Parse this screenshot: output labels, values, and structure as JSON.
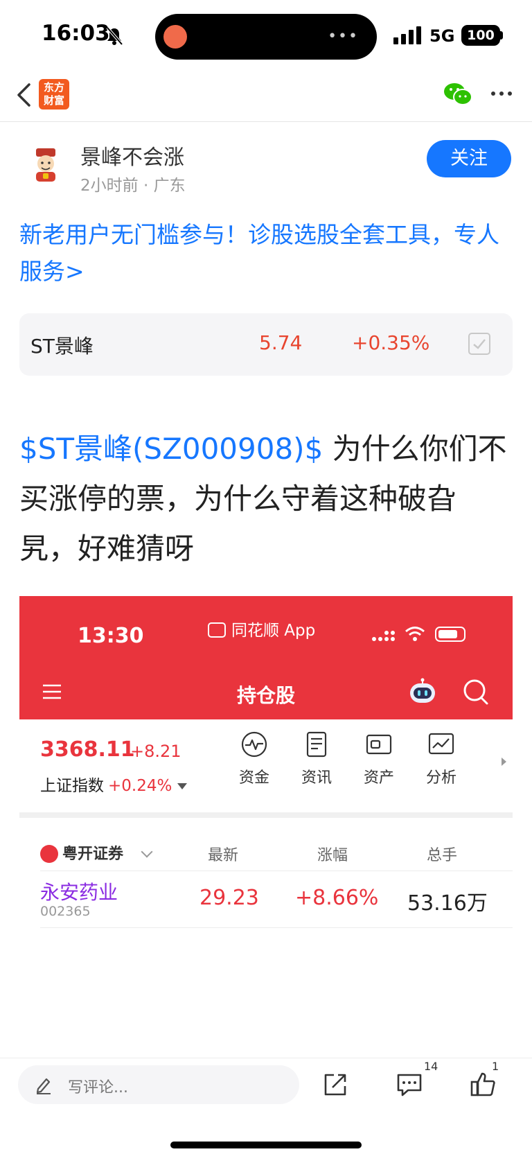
{
  "status_bar": {
    "time": "16:03",
    "network": "5G",
    "battery": "100"
  },
  "nav": {
    "logo_text": "东方财富",
    "back_icon": "chevron-left-icon",
    "share_icon": "wechat-icon",
    "more_icon": "more-icon"
  },
  "author": {
    "name": "景峰不会涨",
    "meta": "2小时前 · 广东",
    "follow_label": "关注"
  },
  "promo": {
    "text": "新老用户无门槛参与！诊股选股全套工具，专人服务>"
  },
  "stock_card": {
    "name": "ST景峰",
    "price": "5.74",
    "change": "+0.35%"
  },
  "post": {
    "stock_tag": "$ST景峰(SZ000908)$",
    "text": "为什么你们不买涨停的票，为什么守着这种破旮旯，好难猜呀"
  },
  "embedded_screenshot": {
    "time": "13:30",
    "app_label": "同花顺 App",
    "title": "持仓股",
    "index": {
      "value": "3368.11",
      "change": "+8.21",
      "name": "上证指数",
      "pct": "+0.24%"
    },
    "tools": [
      {
        "label": "资金",
        "icon": "pulse-icon"
      },
      {
        "label": "资讯",
        "icon": "document-icon"
      },
      {
        "label": "资产",
        "icon": "wallet-icon"
      },
      {
        "label": "分析",
        "icon": "chart-icon"
      }
    ],
    "table": {
      "broker": "粤开证券",
      "headers": [
        "最新",
        "涨幅",
        "总手"
      ],
      "rows": [
        {
          "name": "永安药业",
          "code": "002365",
          "price": "29.23",
          "change": "+8.66%",
          "volume": "53.16万"
        }
      ]
    },
    "colors": {
      "header": "#e9343d",
      "up": "#e9343d",
      "name": "#8a2be2"
    }
  },
  "bottom_bar": {
    "comment_placeholder": "写评论...",
    "comment_count": "14",
    "like_count": "1"
  },
  "colors": {
    "accent": "#1677ff",
    "up": "#e8452f",
    "brand": "#f25a1f"
  }
}
